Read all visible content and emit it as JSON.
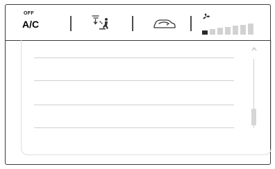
{
  "climate": {
    "ac": {
      "status_label": "OFF",
      "label": "A/C"
    },
    "airflow_icon": "air-distribution-icon",
    "recirculation_icon": "air-recirculation-icon",
    "fan": {
      "icon": "fan-icon",
      "levels": 7,
      "current_level": 1
    }
  },
  "list": {
    "rows": [
      "",
      "",
      "",
      ""
    ],
    "scroll_up_icon": "chevron-up-icon",
    "scroll_position": 0.85
  }
}
